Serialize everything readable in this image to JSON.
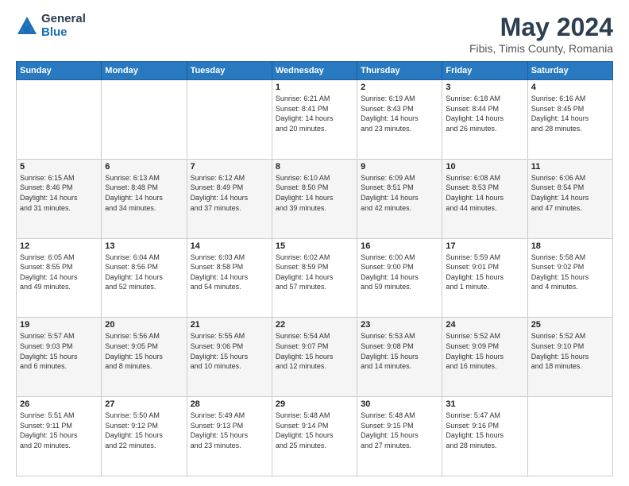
{
  "logo": {
    "general": "General",
    "blue": "Blue"
  },
  "title": "May 2024",
  "subtitle": "Fibis, Timis County, Romania",
  "weekdays": [
    "Sunday",
    "Monday",
    "Tuesday",
    "Wednesday",
    "Thursday",
    "Friday",
    "Saturday"
  ],
  "weeks": [
    [
      {
        "day": "",
        "info": ""
      },
      {
        "day": "",
        "info": ""
      },
      {
        "day": "",
        "info": ""
      },
      {
        "day": "1",
        "info": "Sunrise: 6:21 AM\nSunset: 8:41 PM\nDaylight: 14 hours\nand 20 minutes."
      },
      {
        "day": "2",
        "info": "Sunrise: 6:19 AM\nSunset: 8:43 PM\nDaylight: 14 hours\nand 23 minutes."
      },
      {
        "day": "3",
        "info": "Sunrise: 6:18 AM\nSunset: 8:44 PM\nDaylight: 14 hours\nand 26 minutes."
      },
      {
        "day": "4",
        "info": "Sunrise: 6:16 AM\nSunset: 8:45 PM\nDaylight: 14 hours\nand 28 minutes."
      }
    ],
    [
      {
        "day": "5",
        "info": "Sunrise: 6:15 AM\nSunset: 8:46 PM\nDaylight: 14 hours\nand 31 minutes."
      },
      {
        "day": "6",
        "info": "Sunrise: 6:13 AM\nSunset: 8:48 PM\nDaylight: 14 hours\nand 34 minutes."
      },
      {
        "day": "7",
        "info": "Sunrise: 6:12 AM\nSunset: 8:49 PM\nDaylight: 14 hours\nand 37 minutes."
      },
      {
        "day": "8",
        "info": "Sunrise: 6:10 AM\nSunset: 8:50 PM\nDaylight: 14 hours\nand 39 minutes."
      },
      {
        "day": "9",
        "info": "Sunrise: 6:09 AM\nSunset: 8:51 PM\nDaylight: 14 hours\nand 42 minutes."
      },
      {
        "day": "10",
        "info": "Sunrise: 6:08 AM\nSunset: 8:53 PM\nDaylight: 14 hours\nand 44 minutes."
      },
      {
        "day": "11",
        "info": "Sunrise: 6:06 AM\nSunset: 8:54 PM\nDaylight: 14 hours\nand 47 minutes."
      }
    ],
    [
      {
        "day": "12",
        "info": "Sunrise: 6:05 AM\nSunset: 8:55 PM\nDaylight: 14 hours\nand 49 minutes."
      },
      {
        "day": "13",
        "info": "Sunrise: 6:04 AM\nSunset: 8:56 PM\nDaylight: 14 hours\nand 52 minutes."
      },
      {
        "day": "14",
        "info": "Sunrise: 6:03 AM\nSunset: 8:58 PM\nDaylight: 14 hours\nand 54 minutes."
      },
      {
        "day": "15",
        "info": "Sunrise: 6:02 AM\nSunset: 8:59 PM\nDaylight: 14 hours\nand 57 minutes."
      },
      {
        "day": "16",
        "info": "Sunrise: 6:00 AM\nSunset: 9:00 PM\nDaylight: 14 hours\nand 59 minutes."
      },
      {
        "day": "17",
        "info": "Sunrise: 5:59 AM\nSunset: 9:01 PM\nDaylight: 15 hours\nand 1 minute."
      },
      {
        "day": "18",
        "info": "Sunrise: 5:58 AM\nSunset: 9:02 PM\nDaylight: 15 hours\nand 4 minutes."
      }
    ],
    [
      {
        "day": "19",
        "info": "Sunrise: 5:57 AM\nSunset: 9:03 PM\nDaylight: 15 hours\nand 6 minutes."
      },
      {
        "day": "20",
        "info": "Sunrise: 5:56 AM\nSunset: 9:05 PM\nDaylight: 15 hours\nand 8 minutes."
      },
      {
        "day": "21",
        "info": "Sunrise: 5:55 AM\nSunset: 9:06 PM\nDaylight: 15 hours\nand 10 minutes."
      },
      {
        "day": "22",
        "info": "Sunrise: 5:54 AM\nSunset: 9:07 PM\nDaylight: 15 hours\nand 12 minutes."
      },
      {
        "day": "23",
        "info": "Sunrise: 5:53 AM\nSunset: 9:08 PM\nDaylight: 15 hours\nand 14 minutes."
      },
      {
        "day": "24",
        "info": "Sunrise: 5:52 AM\nSunset: 9:09 PM\nDaylight: 15 hours\nand 16 minutes."
      },
      {
        "day": "25",
        "info": "Sunrise: 5:52 AM\nSunset: 9:10 PM\nDaylight: 15 hours\nand 18 minutes."
      }
    ],
    [
      {
        "day": "26",
        "info": "Sunrise: 5:51 AM\nSunset: 9:11 PM\nDaylight: 15 hours\nand 20 minutes."
      },
      {
        "day": "27",
        "info": "Sunrise: 5:50 AM\nSunset: 9:12 PM\nDaylight: 15 hours\nand 22 minutes."
      },
      {
        "day": "28",
        "info": "Sunrise: 5:49 AM\nSunset: 9:13 PM\nDaylight: 15 hours\nand 23 minutes."
      },
      {
        "day": "29",
        "info": "Sunrise: 5:48 AM\nSunset: 9:14 PM\nDaylight: 15 hours\nand 25 minutes."
      },
      {
        "day": "30",
        "info": "Sunrise: 5:48 AM\nSunset: 9:15 PM\nDaylight: 15 hours\nand 27 minutes."
      },
      {
        "day": "31",
        "info": "Sunrise: 5:47 AM\nSunset: 9:16 PM\nDaylight: 15 hours\nand 28 minutes."
      },
      {
        "day": "",
        "info": ""
      }
    ]
  ]
}
